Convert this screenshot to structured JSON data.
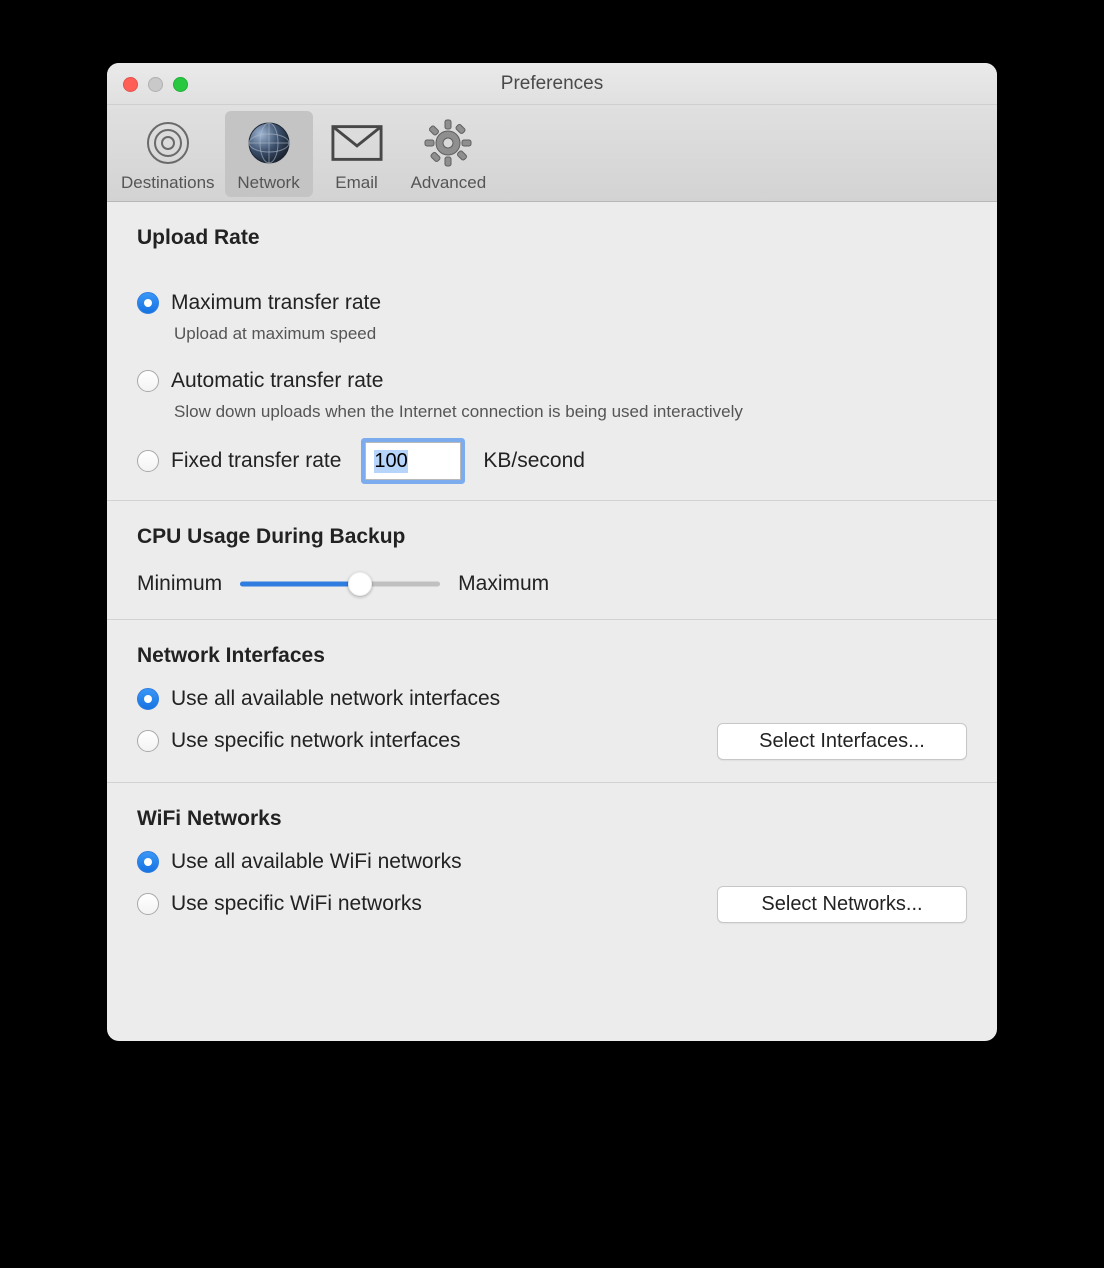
{
  "window": {
    "title": "Preferences"
  },
  "toolbar": {
    "destinations": "Destinations",
    "network": "Network",
    "email": "Email",
    "advanced": "Advanced",
    "selected": "Network"
  },
  "uploadRate": {
    "heading": "Upload Rate",
    "max": {
      "label": "Maximum transfer rate",
      "sub": "Upload at maximum speed",
      "selected": true
    },
    "auto": {
      "label": "Automatic transfer rate",
      "sub": "Slow down uploads when the Internet connection is being used interactively",
      "selected": false
    },
    "fixed": {
      "label": "Fixed transfer rate",
      "value": "100",
      "unit": "KB/second",
      "selected": false
    }
  },
  "cpu": {
    "heading": "CPU Usage During Backup",
    "minLabel": "Minimum",
    "maxLabel": "Maximum",
    "percent": 60
  },
  "interfaces": {
    "heading": "Network Interfaces",
    "all": {
      "label": "Use all available network interfaces",
      "selected": true
    },
    "specific": {
      "label": "Use specific network interfaces",
      "selected": false
    },
    "button": "Select Interfaces..."
  },
  "wifi": {
    "heading": "WiFi Networks",
    "all": {
      "label": "Use all available WiFi networks",
      "selected": true
    },
    "specific": {
      "label": "Use specific WiFi networks",
      "selected": false
    },
    "button": "Select Networks..."
  }
}
